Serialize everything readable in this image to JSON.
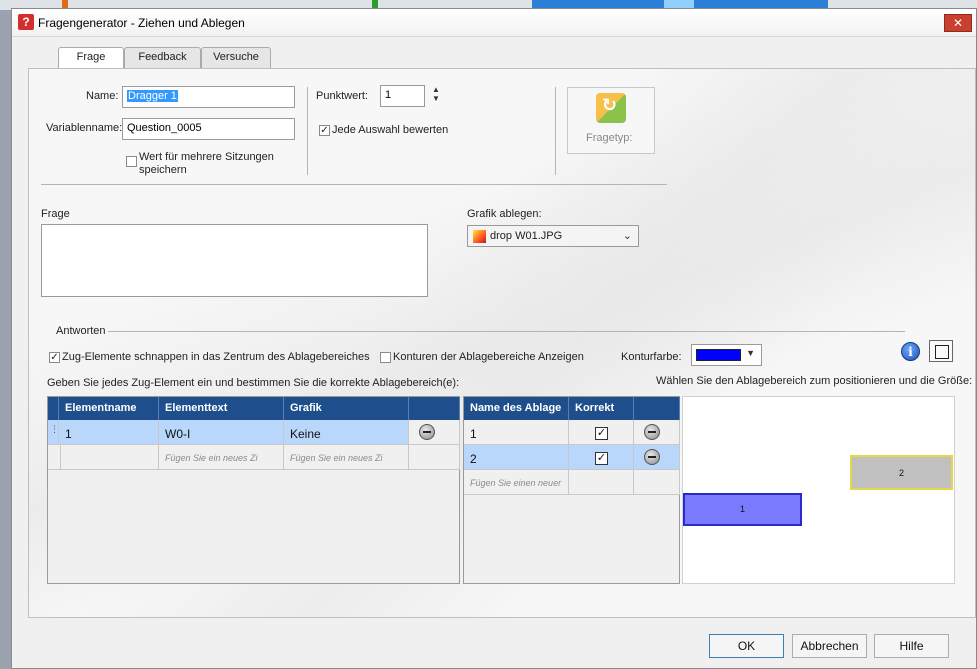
{
  "window": {
    "title": "Fragengenerator - Ziehen und Ablegen",
    "close_label": "✕",
    "title_icon": "?"
  },
  "tabs": [
    {
      "label": "Frage"
    },
    {
      "label": "Feedback"
    },
    {
      "label": "Versuche"
    }
  ],
  "form": {
    "name_label": "Name:",
    "name_value": "Dragger 1",
    "variable_label": "Variablenname:",
    "variable_value": "Question_0005",
    "multi_session_label": "Wert für mehrere Sitzungen speichern",
    "multi_session_checked": false,
    "points_label": "Punktwert:",
    "points_value": "1",
    "score_each_label": "Jede Auswahl bewerten",
    "score_each_checked": true,
    "question_type_label": "Fragetyp:",
    "question_label": "Frage",
    "question_value": "",
    "drop_image_label": "Grafik ablegen:",
    "drop_image_value": "drop W01.JPG"
  },
  "answers": {
    "section_label": "Antworten",
    "snap_label": "Zug-Elemente schnappen in das Zentrum des Ablagebereiches",
    "snap_checked": true,
    "outline_label": "Konturen der Ablagebereiche Anzeigen",
    "outline_checked": false,
    "outline_color_label": "Konturfarbe:",
    "outline_color": "#0000ff",
    "left_instruction": "Geben Sie jedes Zug-Element ein und bestimmen Sie die korrekte Ablagebereich(e):",
    "right_instruction": "Wählen Sie den Ablagebereich zum positionieren und die Größe:"
  },
  "elements_table": {
    "columns": [
      "Elementname",
      "Elementtext",
      "Grafik",
      ""
    ],
    "rows": [
      {
        "name": "1",
        "text": "W0-I",
        "graphic": "Keine"
      }
    ],
    "new_row_placeholder": "Fügen Sie ein neues Zi"
  },
  "zones_table": {
    "columns": [
      "Name des Ablage",
      "Korrekt",
      ""
    ],
    "rows": [
      {
        "name": "1",
        "correct": true
      },
      {
        "name": "2",
        "correct": true
      }
    ],
    "new_row_placeholder": "Fügen Sie einen neuer"
  },
  "drop_zones": [
    {
      "label": "2",
      "fill": "#c0c0c0",
      "border": "#e3d84a"
    },
    {
      "label": "1",
      "fill": "#7a7aff",
      "border": "#2a2acc"
    }
  ],
  "buttons": {
    "ok": "OK",
    "cancel": "Abbrechen",
    "help": "Hilfe"
  },
  "icons": {
    "info": "i",
    "minus": "remove-circle-icon"
  },
  "colors": {
    "table_header": "#1f4e8c",
    "selected_row": "#b9d7fb"
  }
}
